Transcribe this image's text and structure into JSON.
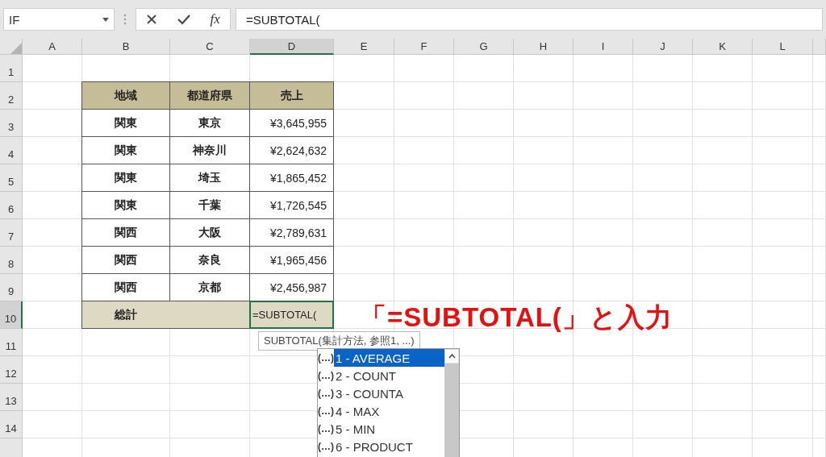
{
  "formula_bar": {
    "name_box": "IF",
    "insert_function": "fx",
    "formula": "=SUBTOTAL("
  },
  "columns": [
    {
      "label": "A",
      "selected": false
    },
    {
      "label": "B",
      "selected": false
    },
    {
      "label": "C",
      "selected": false
    },
    {
      "label": "D",
      "selected": true
    },
    {
      "label": "E",
      "selected": false
    },
    {
      "label": "F",
      "selected": false
    },
    {
      "label": "G",
      "selected": false
    },
    {
      "label": "H",
      "selected": false
    },
    {
      "label": "I",
      "selected": false
    },
    {
      "label": "J",
      "selected": false
    },
    {
      "label": "K",
      "selected": false
    },
    {
      "label": "L",
      "selected": false
    }
  ],
  "rows": [
    {
      "label": "1",
      "selected": false
    },
    {
      "label": "2",
      "selected": false
    },
    {
      "label": "3",
      "selected": false
    },
    {
      "label": "4",
      "selected": false
    },
    {
      "label": "5",
      "selected": false
    },
    {
      "label": "6",
      "selected": false
    },
    {
      "label": "7",
      "selected": false
    },
    {
      "label": "8",
      "selected": false
    },
    {
      "label": "9",
      "selected": false
    },
    {
      "label": "10",
      "selected": true
    },
    {
      "label": "11",
      "selected": false
    },
    {
      "label": "12",
      "selected": false
    },
    {
      "label": "13",
      "selected": false
    },
    {
      "label": "14",
      "selected": false
    }
  ],
  "table": {
    "header": [
      "地域",
      "都道府県",
      "売上"
    ],
    "rows": [
      [
        "関東",
        "東京",
        "¥3,645,955"
      ],
      [
        "関東",
        "神奈川",
        "¥2,624,632"
      ],
      [
        "関東",
        "埼玉",
        "¥1,865,452"
      ],
      [
        "関東",
        "千葉",
        "¥1,726,545"
      ],
      [
        "関西",
        "大阪",
        "¥2,789,631"
      ],
      [
        "関西",
        "奈良",
        "¥1,965,456"
      ],
      [
        "関西",
        "京都",
        "¥2,456,987"
      ]
    ],
    "total": {
      "label": "総計",
      "editing": "=SUBTOTAL("
    }
  },
  "tooltip": "SUBTOTAL(集計方法, 参照1, ...)",
  "autocomplete": [
    {
      "marker": "(…)",
      "label": "1 - AVERAGE",
      "selected": true
    },
    {
      "marker": "(…)",
      "label": "2 - COUNT",
      "selected": false
    },
    {
      "marker": "(…)",
      "label": "3 - COUNTA",
      "selected": false
    },
    {
      "marker": "(…)",
      "label": "4 - MAX",
      "selected": false
    },
    {
      "marker": "(…)",
      "label": "5 - MIN",
      "selected": false
    },
    {
      "marker": "(…)",
      "label": "6 - PRODUCT",
      "selected": false
    }
  ],
  "annotation": "「=SUBTOTAL(」と入力"
}
